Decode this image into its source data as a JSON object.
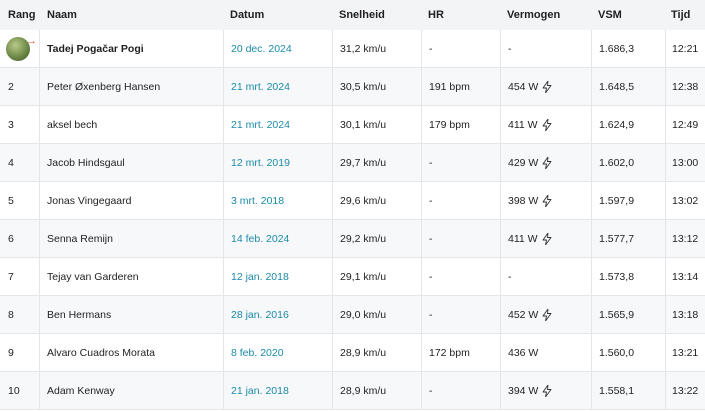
{
  "headers": {
    "rank": "Rang",
    "name": "Naam",
    "date": "Datum",
    "speed": "Snelheid",
    "hr": "HR",
    "power": "Vermogen",
    "vsm": "VSM",
    "time": "Tijd"
  },
  "rows": [
    {
      "rank": "",
      "avatar": true,
      "name": "Tadej Pogačar Pogi",
      "date": "20 dec. 2024",
      "speed": "31,2 km/u",
      "hr": "-",
      "power": "-",
      "power_icon": false,
      "vsm": "1.686,3",
      "time": "12:21"
    },
    {
      "rank": "2",
      "name": "Peter Øxenberg Hansen",
      "date": "21 mrt. 2024",
      "speed": "30,5 km/u",
      "hr": "191 bpm",
      "power": "454 W",
      "power_icon": true,
      "vsm": "1.648,5",
      "time": "12:38"
    },
    {
      "rank": "3",
      "name": "aksel bech",
      "date": "21 mrt. 2024",
      "speed": "30,1 km/u",
      "hr": "179 bpm",
      "power": "411 W",
      "power_icon": true,
      "vsm": "1.624,9",
      "time": "12:49"
    },
    {
      "rank": "4",
      "name": "Jacob Hindsgaul",
      "date": "12 mrt. 2019",
      "speed": "29,7 km/u",
      "hr": "-",
      "power": "429 W",
      "power_icon": true,
      "vsm": "1.602,0",
      "time": "13:00"
    },
    {
      "rank": "5",
      "name": "Jonas Vingegaard",
      "date": "3 mrt. 2018",
      "speed": "29,6 km/u",
      "hr": "-",
      "power": "398 W",
      "power_icon": true,
      "vsm": "1.597,9",
      "time": "13:02"
    },
    {
      "rank": "6",
      "name": "Senna Remijn",
      "date": "14 feb. 2024",
      "speed": "29,2 km/u",
      "hr": "-",
      "power": "411 W",
      "power_icon": true,
      "vsm": "1.577,7",
      "time": "13:12"
    },
    {
      "rank": "7",
      "name": "Tejay van Garderen",
      "date": "12 jan. 2018",
      "speed": "29,1 km/u",
      "hr": "-",
      "power": "-",
      "power_icon": false,
      "vsm": "1.573,8",
      "time": "13:14"
    },
    {
      "rank": "8",
      "name": "Ben Hermans",
      "date": "28 jan. 2016",
      "speed": "29,0 km/u",
      "hr": "-",
      "power": "452 W",
      "power_icon": true,
      "vsm": "1.565,9",
      "time": "13:18"
    },
    {
      "rank": "9",
      "name": "Alvaro Cuadros Morata",
      "date": "8 feb. 2020",
      "speed": "28,9 km/u",
      "hr": "172 bpm",
      "power": "436 W",
      "power_icon": false,
      "vsm": "1.560,0",
      "time": "13:21"
    },
    {
      "rank": "10",
      "name": "Adam Kenway",
      "date": "21 jan. 2018",
      "speed": "28,9 km/u",
      "hr": "-",
      "power": "394 W",
      "power_icon": true,
      "vsm": "1.558,1",
      "time": "13:22"
    }
  ],
  "colors": {
    "date_link": "#1b8aa8",
    "header_bg": "#f3f4f6",
    "stripe_bg": "#f7f8fa"
  },
  "icons": {
    "power_estimated": "lightning-bolt-icon",
    "first_place_avatar": "avatar-icon"
  }
}
